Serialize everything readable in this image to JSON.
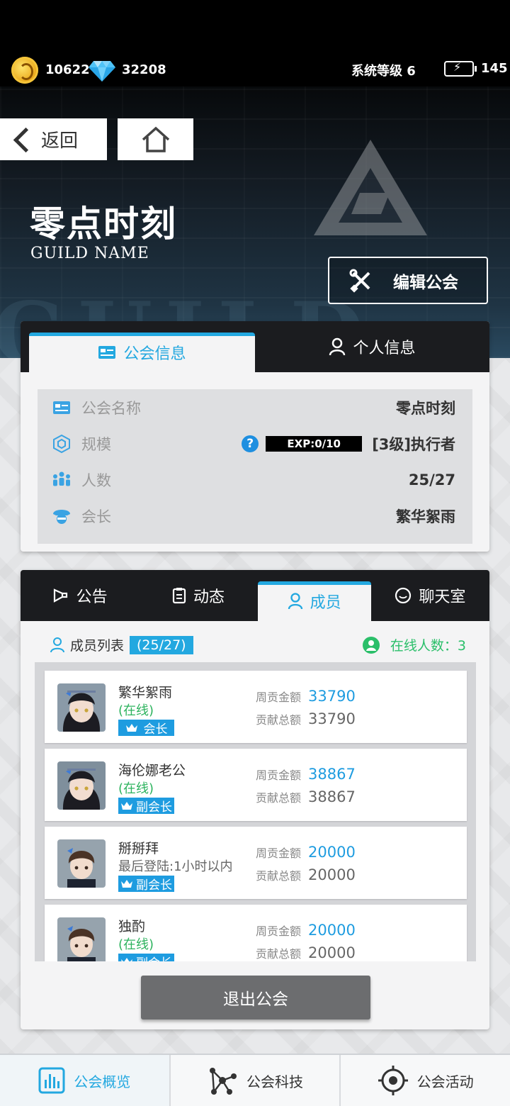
{
  "colors": {
    "accent": "#23a8e0",
    "online": "#2db35e",
    "gold": "#e9a314"
  },
  "status": {
    "coins": "10622",
    "gems": "32208",
    "system_level": "系统等级 6",
    "energy": "145"
  },
  "nav": {
    "back_label": "返回"
  },
  "guild": {
    "title": "零点时刻",
    "subtitle": "GUILD NAME",
    "edit_label": "编辑公会"
  },
  "info_tabs": [
    {
      "label": "公会信息",
      "icon": "id-card-icon"
    },
    {
      "label": "个人信息",
      "icon": "person-icon"
    }
  ],
  "info": {
    "rows": [
      {
        "label": "公会名称",
        "value": "零点时刻",
        "icon": "id-card-icon"
      },
      {
        "label": "规模",
        "value": "[3级]执行者",
        "exp": "EXP:0/10",
        "icon": "scale-icon"
      },
      {
        "label": "人数",
        "value": "25/27",
        "icon": "people-icon"
      },
      {
        "label": "会长",
        "value": "繁华絮雨",
        "icon": "leader-icon"
      }
    ],
    "help": "?"
  },
  "member_tabs": [
    {
      "label": "公告",
      "icon": "megaphone-icon"
    },
    {
      "label": "动态",
      "icon": "clipboard-icon"
    },
    {
      "label": "成员",
      "icon": "person-icon"
    },
    {
      "label": "聊天室",
      "icon": "chat-icon"
    }
  ],
  "members_header": {
    "list_label": "成员列表",
    "count": "(25/27)",
    "online_label": "在线人数：3"
  },
  "members": [
    {
      "name": "繁华絮雨",
      "status": "(在线)",
      "online": true,
      "role": "会长",
      "weekly_label": "周贡金额",
      "weekly": "33790",
      "total_label": "贡献总额",
      "total": "33790"
    },
    {
      "name": "海伦娜老公",
      "status": "(在线)",
      "online": true,
      "role": "副会长",
      "weekly_label": "周贡金额",
      "weekly": "38867",
      "total_label": "贡献总额",
      "total": "38867"
    },
    {
      "name": "掰掰拜",
      "status": "最后登陆:1小时以内",
      "online": false,
      "role": "副会长",
      "weekly_label": "周贡金额",
      "weekly": "20000",
      "total_label": "贡献总额",
      "total": "20000"
    },
    {
      "name": "独酌",
      "status": "(在线)",
      "online": true,
      "role": "副会长",
      "weekly_label": "周贡金额",
      "weekly": "20000",
      "total_label": "贡献总额",
      "total": "20000"
    }
  ],
  "quit_label": "退出公会",
  "bottom_nav": [
    {
      "label": "公会概览",
      "icon": "chart-icon"
    },
    {
      "label": "公会科技",
      "icon": "network-icon"
    },
    {
      "label": "公会活动",
      "icon": "target-icon"
    }
  ]
}
